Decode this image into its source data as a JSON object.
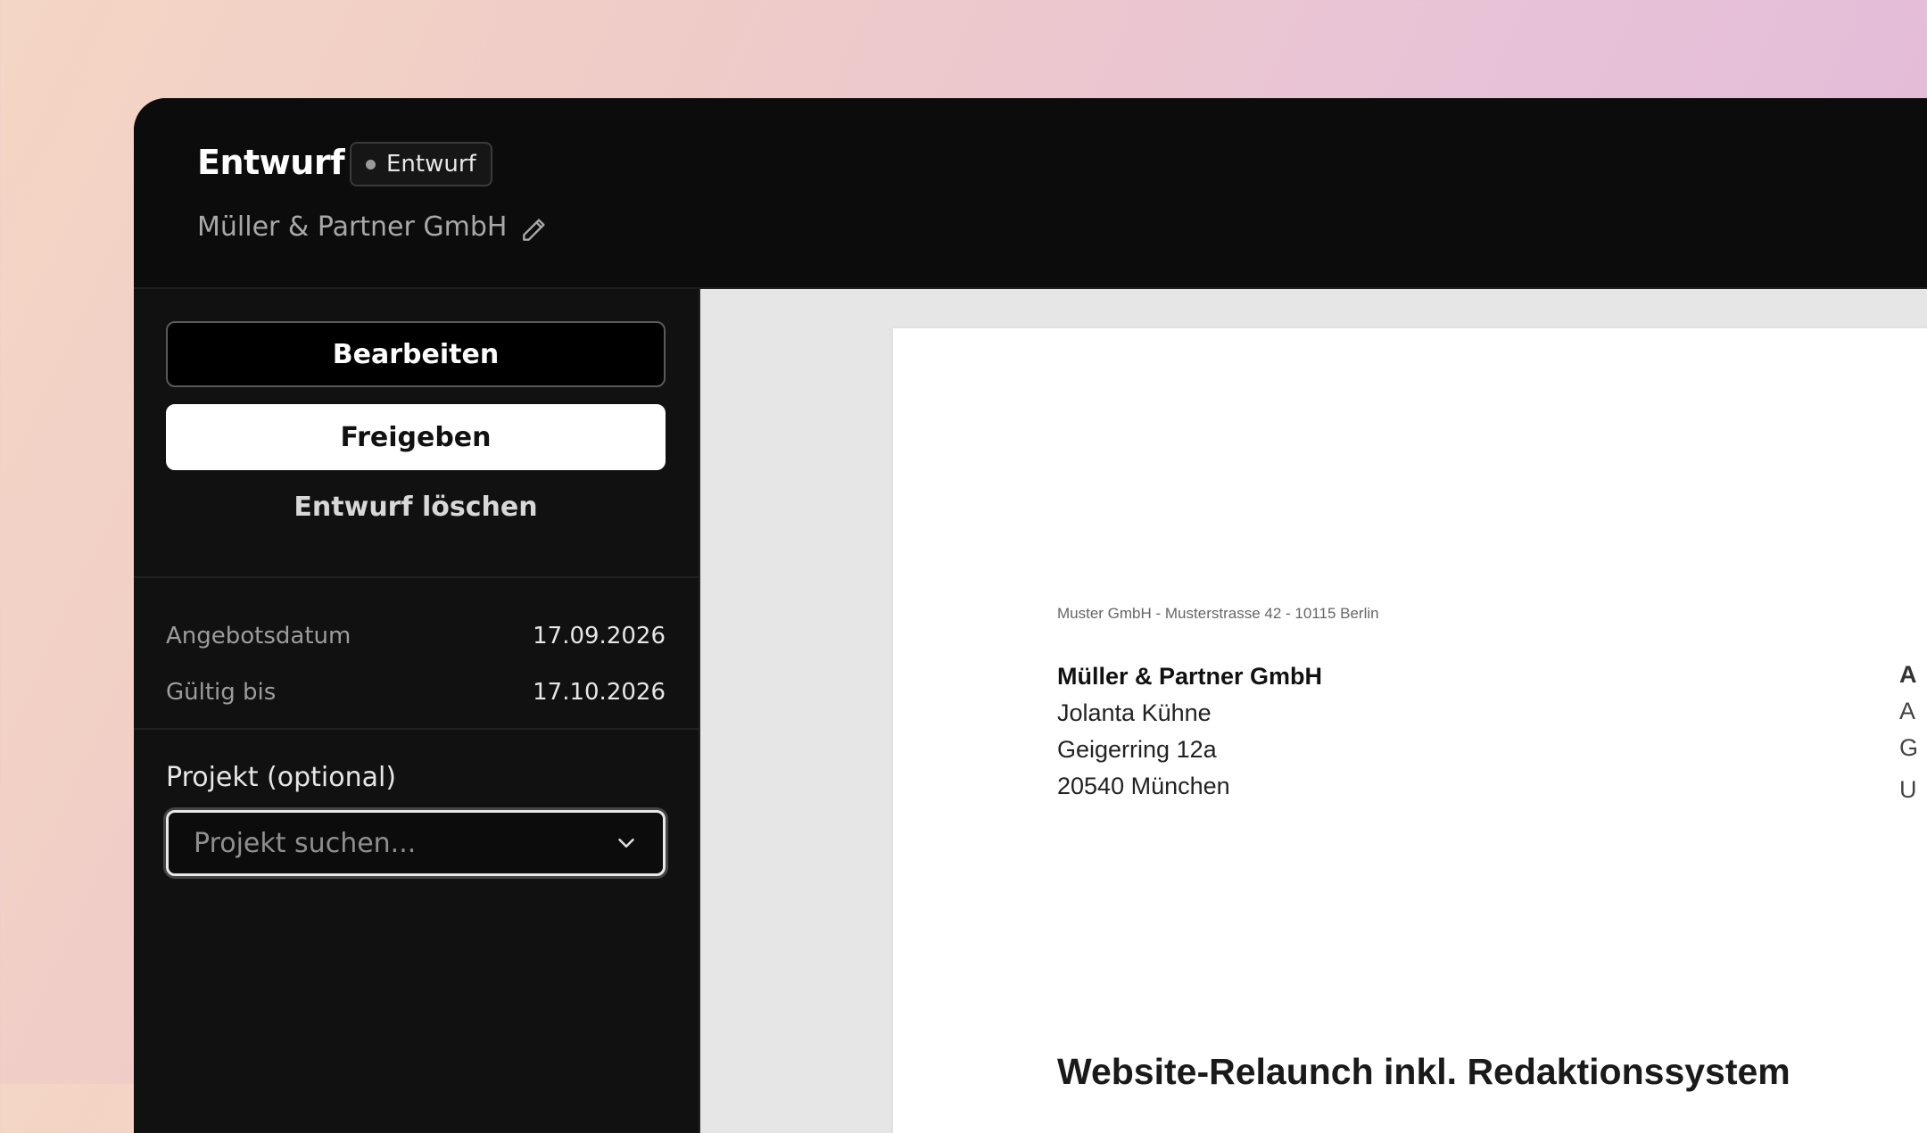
{
  "header": {
    "title": "Entwurf",
    "badge": "Entwurf",
    "client": "Müller & Partner GmbH"
  },
  "sidebar": {
    "edit_label": "Bearbeiten",
    "release_label": "Freigeben",
    "delete_label": "Entwurf löschen",
    "details": [
      {
        "label": "Angebotsdatum",
        "value": "17.09.2026"
      },
      {
        "label": "Gültig bis",
        "value": "17.10.2026"
      }
    ],
    "project": {
      "label": "Projekt (optional)",
      "placeholder": "Projekt suchen...",
      "value": ""
    }
  },
  "document": {
    "sender_line": "Muster GmbH - Musterstrasse 42 - 10115 Berlin",
    "recipient": {
      "company": "Müller & Partner GmbH",
      "contact": "Jolanta Kühne",
      "street": "Geigerring 12a",
      "city": "20540 München"
    },
    "right_column": [
      "A",
      "A",
      "G",
      "U"
    ],
    "title": "Website-Relaunch inkl. Redaktionssystem"
  },
  "icons": {
    "edit": "pencil-icon",
    "dropdown": "chevron-down-icon",
    "status_dot": "status-dot-icon"
  },
  "colors": {
    "app_bg": "#0c0c0c",
    "sidebar_bg": "#111111",
    "preview_bg": "#e6e6e6",
    "paper_bg": "#ffffff"
  }
}
